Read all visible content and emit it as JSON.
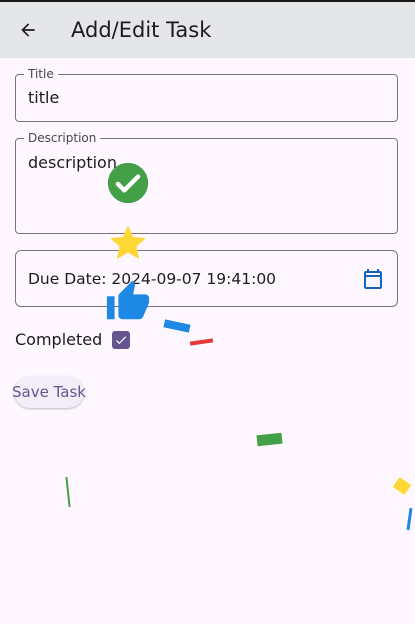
{
  "app_bar": {
    "title": "Add/Edit Task",
    "back_icon": "arrow-back-icon"
  },
  "form": {
    "title_field": {
      "label": "Title",
      "value": "title"
    },
    "description_field": {
      "label": "Description",
      "value": "description"
    },
    "due_date_field": {
      "value": "Due Date: 2024-09-07 19:41:00",
      "icon": "calendar-icon"
    },
    "completed": {
      "label": "Completed",
      "checked": true
    },
    "save_button": {
      "label": "Save Task"
    }
  },
  "celebration_overlay": {
    "icons": [
      "check-circle-icon",
      "star-icon",
      "thumbs-up-icon"
    ],
    "confetti_colors": [
      "#1E88E5",
      "#E53935",
      "#43A047",
      "#FDD835",
      "#1E88E5",
      "#43A047"
    ]
  },
  "colors": {
    "background": "#FEF7FF",
    "app_bar": "#E4E6E8",
    "primary": "#65558F",
    "check_green": "#43A047",
    "star_yellow": "#FDD835",
    "thumb_blue": "#1E88E5"
  }
}
